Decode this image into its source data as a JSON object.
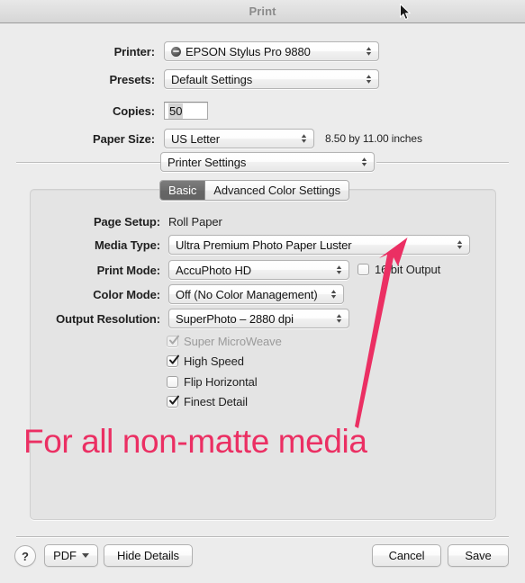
{
  "window": {
    "title": "Print"
  },
  "top_form": {
    "printer": {
      "label": "Printer:",
      "value": "EPSON Stylus Pro 9880",
      "icon": "printer-status-icon"
    },
    "presets": {
      "label": "Presets:",
      "value": "Default Settings"
    },
    "copies": {
      "label": "Copies:",
      "value": "50"
    },
    "paper_size": {
      "label": "Paper Size:",
      "value": "US Letter",
      "dimensions": "8.50 by 11.00 inches"
    },
    "pane_selector": {
      "value": "Printer Settings"
    }
  },
  "tabs": [
    {
      "label": "Basic",
      "selected": true
    },
    {
      "label": "Advanced Color Settings",
      "selected": false
    }
  ],
  "settings": {
    "page_setup": {
      "label": "Page Setup:",
      "value": "Roll Paper"
    },
    "media_type": {
      "label": "Media Type:",
      "value": "Ultra Premium Photo Paper Luster"
    },
    "print_mode": {
      "label": "Print Mode:",
      "value": "AccuPhoto HD"
    },
    "sixteen_bit": {
      "label": "16 bit Output",
      "checked": false
    },
    "color_mode": {
      "label": "Color Mode:",
      "value": "Off (No Color Management)"
    },
    "output_resolution": {
      "label": "Output Resolution:",
      "value": "SuperPhoto – 2880 dpi"
    },
    "checkboxes": [
      {
        "label": "Super MicroWeave",
        "checked": true,
        "disabled": true
      },
      {
        "label": "High Speed",
        "checked": true,
        "disabled": false
      },
      {
        "label": "Flip Horizontal",
        "checked": false,
        "disabled": false
      },
      {
        "label": "Finest Detail",
        "checked": true,
        "disabled": false
      }
    ]
  },
  "annotation": {
    "text": "For all non-matte media",
    "color": "#eb2f63",
    "arrow": "pink-arrow-pointing-to-media-type"
  },
  "bottom_bar": {
    "help": "?",
    "pdf": "PDF",
    "hide_details": "Hide Details",
    "cancel": "Cancel",
    "save": "Save"
  }
}
